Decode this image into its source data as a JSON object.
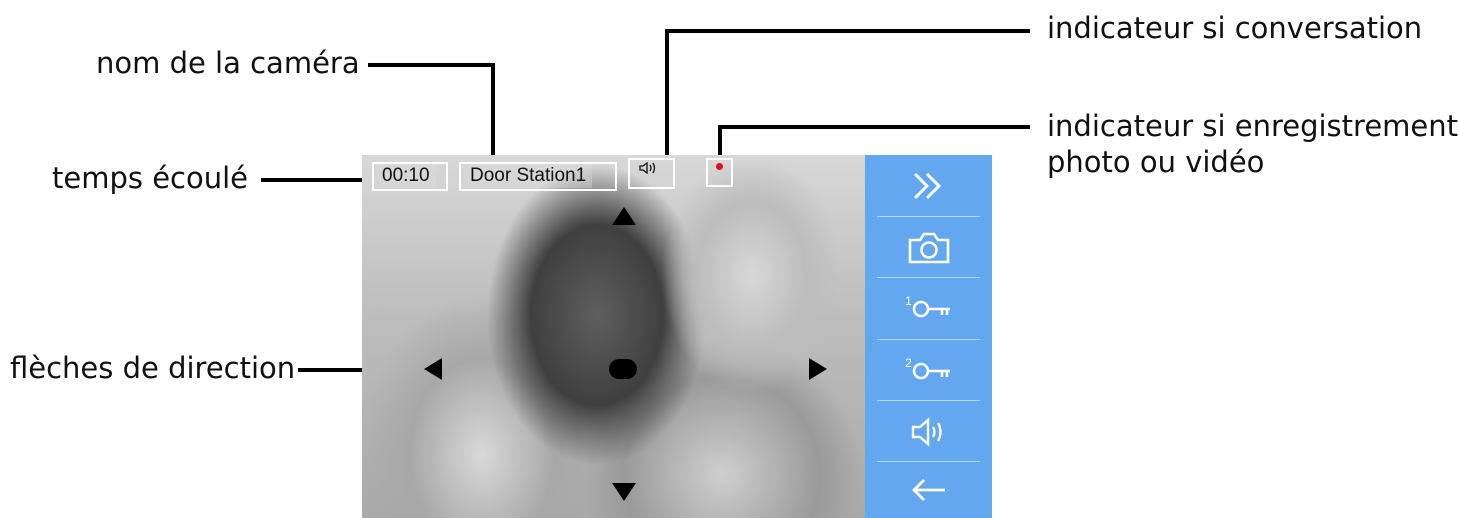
{
  "callouts": {
    "camera_name": "nom de la caméra",
    "elapsed_time": "temps écoulé",
    "direction_arrows": "flèches de direction",
    "conversation_indicator": "indicateur si conversation",
    "recording_indicator_line1": "indicateur si enregistrement",
    "recording_indicator_line2": "photo ou vidéo"
  },
  "screen": {
    "elapsed": "00:10",
    "camera": "Door Station1",
    "recording_dot_color": "#e0101a",
    "sidebar_color": "#62a7ef"
  },
  "sidebar": {
    "items": [
      {
        "icon": "double-chevron-right-icon"
      },
      {
        "icon": "camera-icon"
      },
      {
        "icon": "key-1-icon",
        "label": "1"
      },
      {
        "icon": "key-2-icon",
        "label": "2"
      },
      {
        "icon": "speaker-icon"
      },
      {
        "icon": "back-arrow-icon"
      }
    ]
  }
}
